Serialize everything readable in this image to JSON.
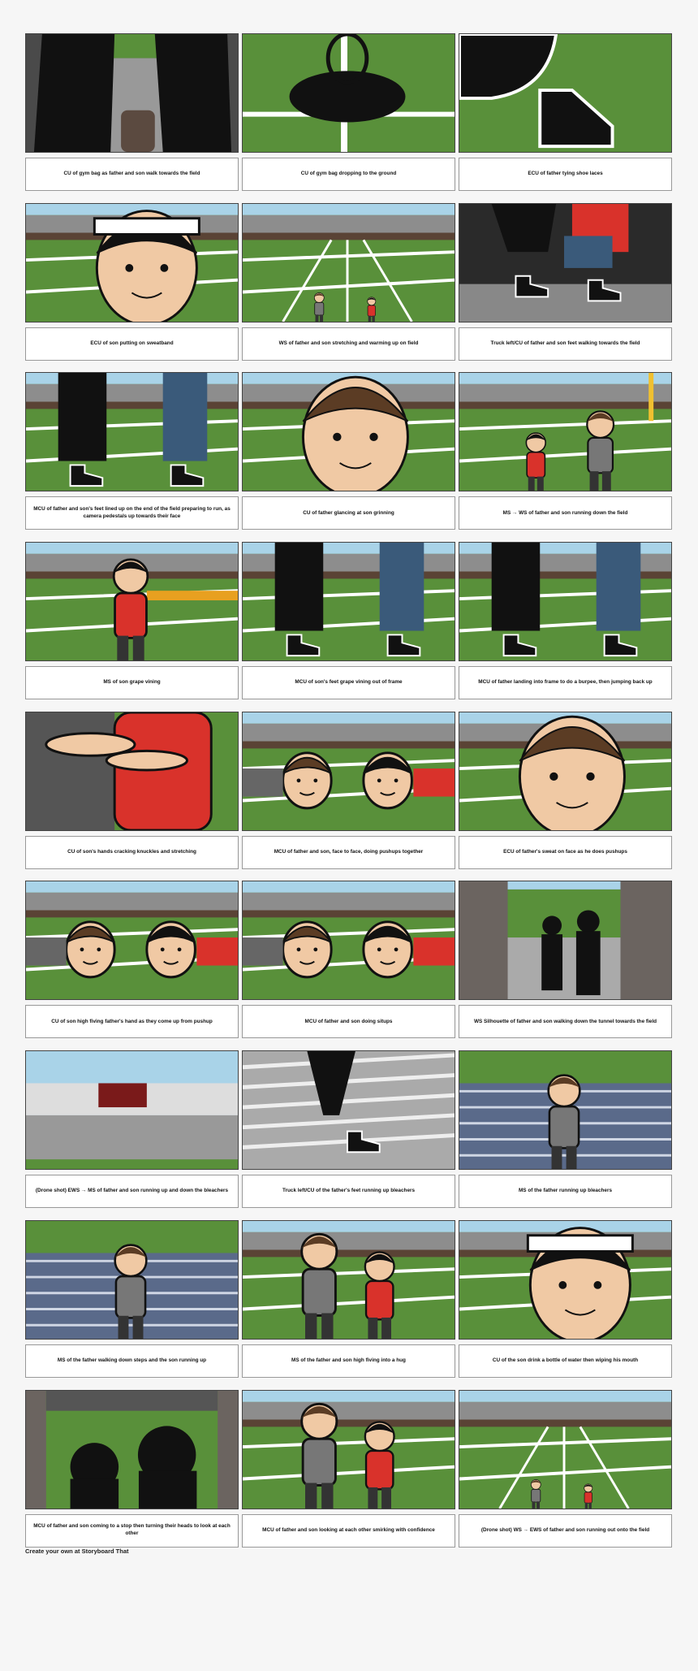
{
  "footer": "Create your own at Storyboard That",
  "scene_colors": {
    "sky": "#a9d3e8",
    "field": "#59903a",
    "line": "#ffffff",
    "stands": "#5a4335",
    "black": "#111111",
    "jersey": "#d9322b",
    "skin": "#f0c9a4",
    "hair": "#5b3c24",
    "tunnel": "#6b6460"
  },
  "panels": [
    {
      "caption": "CU of gym bag as father and son walk towards the field",
      "scene": "silhouette-bag"
    },
    {
      "caption": "CU of gym bag dropping to the ground",
      "scene": "bag"
    },
    {
      "caption": "ECU of father tying shoe laces",
      "scene": "shoe"
    },
    {
      "caption": "ECU of son putting on sweatband",
      "scene": "face-son"
    },
    {
      "caption": "WS of father and son stretching and warming up on field",
      "scene": "wide-field"
    },
    {
      "caption": "Truck left/CU of father and son feet walking towards the field",
      "scene": "feet"
    },
    {
      "caption": "MCU of father and son's feet lined up on the end of the field preparing to run, as camera pedestals up towards their face",
      "scene": "feet-field"
    },
    {
      "caption": "CU of father glancing at son grinning",
      "scene": "face-father"
    },
    {
      "caption": "MS → WS of father and son running down the field",
      "scene": "running"
    },
    {
      "caption": "MS of son grape vining",
      "scene": "son-standing"
    },
    {
      "caption": "MCU of son's feet grape vining out of frame",
      "scene": "feet-field"
    },
    {
      "caption": "MCU of father landing into frame to do a burpee, then jumping back up",
      "scene": "feet-field"
    },
    {
      "caption": "CU of son's hands cracking knuckles and stretching",
      "scene": "hands"
    },
    {
      "caption": "MCU of father and son, face to face, doing pushups together",
      "scene": "pushups"
    },
    {
      "caption": "ECU of father's sweat on face as he does pushups",
      "scene": "face-father"
    },
    {
      "caption": "CU of son high fiving father's hand as they come up from pushup",
      "scene": "pushups"
    },
    {
      "caption": "MCU of father and son doing situps",
      "scene": "pushups"
    },
    {
      "caption": "WS Silhouette of father and son walking down the tunnel towards the field",
      "scene": "tunnel"
    },
    {
      "caption": "(Drone shot) EWS → MS of father and son running up and down the bleachers",
      "scene": "stadium"
    },
    {
      "caption": "Truck left/CU of the father's feet running up bleachers",
      "scene": "bleachers"
    },
    {
      "caption": "MS of the father running up bleachers",
      "scene": "bleachers-man"
    },
    {
      "caption": "MS of the father walking down steps and the son running up",
      "scene": "bleachers-man"
    },
    {
      "caption": "MS of the father and son high fiving into a hug",
      "scene": "two-standing"
    },
    {
      "caption": "CU of the son drink a bottle of water then wiping his mouth",
      "scene": "face-son"
    },
    {
      "caption": "MCU of father and son coming to a stop then turning their heads to look at each other",
      "scene": "tunnel-heads"
    },
    {
      "caption": "MCU of father and son looking at each other smirking with confidence",
      "scene": "two-standing"
    },
    {
      "caption": "(Drone shot) WS → EWS of father and son running out onto the field",
      "scene": "wide-field"
    }
  ]
}
